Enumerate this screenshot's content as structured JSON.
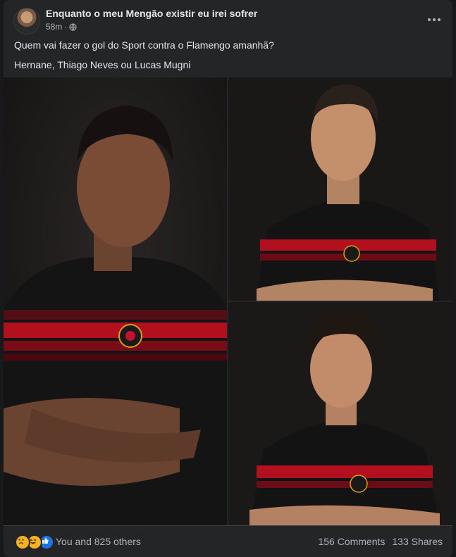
{
  "post": {
    "page_name": "Enquanto o meu Mengão existir eu irei sofrer",
    "time": "58m",
    "separator": "·",
    "privacy_icon": "globe-icon",
    "more_icon": "more-horizontal-icon",
    "text_lines": [
      "Quem vai fazer o gol do Sport contra o Flamengo amanhã?",
      "Hernane, Thiago Neves ou Lucas Mugni"
    ]
  },
  "photos": [
    {
      "name": "photo-hernane",
      "jersey_colors": [
        "#111111",
        "#c8102e"
      ]
    },
    {
      "name": "photo-thiago-neves",
      "jersey_colors": [
        "#111111",
        "#c8102e"
      ]
    },
    {
      "name": "photo-lucas-mugni",
      "jersey_colors": [
        "#111111",
        "#c8102e"
      ]
    }
  ],
  "footer": {
    "reaction_icons": [
      "sad-reaction-icon",
      "haha-reaction-icon",
      "like-reaction-icon"
    ],
    "reaction_text": "You and 825 others",
    "comments": "156 Comments",
    "shares": "133 Shares"
  },
  "colors": {
    "background": "#18191a",
    "card": "#242526",
    "text_primary": "#e4e6eb",
    "text_secondary": "#b0b3b8",
    "like_blue": "#1b74e4",
    "reaction_yellow": "#f7b125"
  }
}
